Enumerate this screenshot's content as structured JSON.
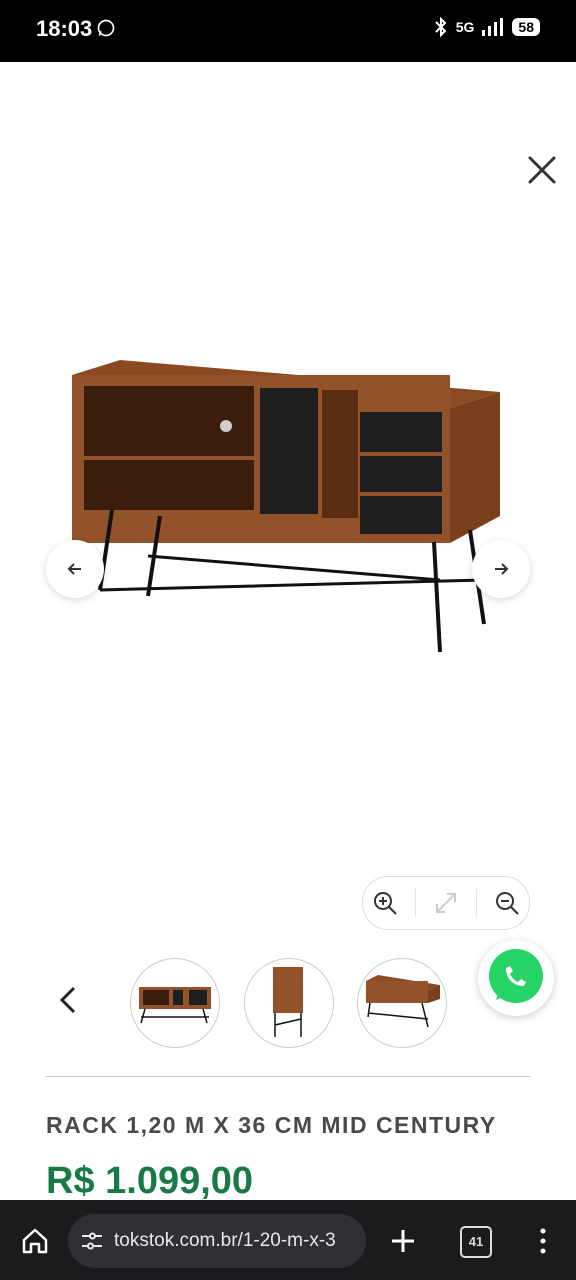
{
  "status_bar": {
    "time": "18:03",
    "network": "5G",
    "battery": "58"
  },
  "product": {
    "title": "RACK 1,20 M X 36 CM MID CENTURY",
    "price": "R$ 1.099,00"
  },
  "browser": {
    "url": "tokstok.com.br/1-20-m-x-3",
    "tab_count": "41"
  },
  "colors": {
    "price": "#1a7a46",
    "whatsapp": "#25d366",
    "browser_bar": "#1b1b1d"
  },
  "icons": [
    "whatsapp-icon",
    "bluetooth-icon",
    "signal-icon",
    "battery-icon",
    "close-icon",
    "arrow-left-icon",
    "arrow-right-icon",
    "zoom-in-icon",
    "expand-icon",
    "zoom-out-icon",
    "chevron-left-icon",
    "home-icon",
    "site-settings-icon",
    "plus-icon",
    "tabs-icon",
    "more-vert-icon"
  ]
}
